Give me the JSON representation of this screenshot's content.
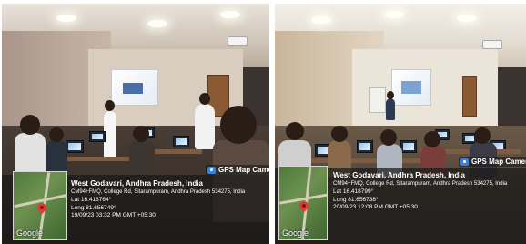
{
  "photos": [
    {
      "id": "left",
      "overlay": {
        "badge_label": "GPS Map Camera",
        "badge_icon": "camera-pin-icon",
        "place": "West Godavari, Andhra Pradesh, India",
        "address": "CM94+FMQ, College Rd, Sitarampuram, Andhra Pradesh 534275, India",
        "lat": "Lat 16.418764°",
        "long": "Long 81.656749°",
        "datetime": "19/09/23 03:32 PM GMT +05:30",
        "map_brand": "Google"
      }
    },
    {
      "id": "right",
      "overlay": {
        "badge_label": "GPS Map Camera",
        "badge_icon": "camera-pin-icon",
        "place": "West Godavari, Andhra Pradesh, India",
        "address": "CM94+FMQ, College Rd, Sitarampuram, Andhra Pradesh 534275, India",
        "lat": "Lat 16.418799°",
        "long": "Long 81.656738°",
        "datetime": "20/09/23 12:08 PM GMT +05:30",
        "map_brand": "Google"
      }
    }
  ]
}
